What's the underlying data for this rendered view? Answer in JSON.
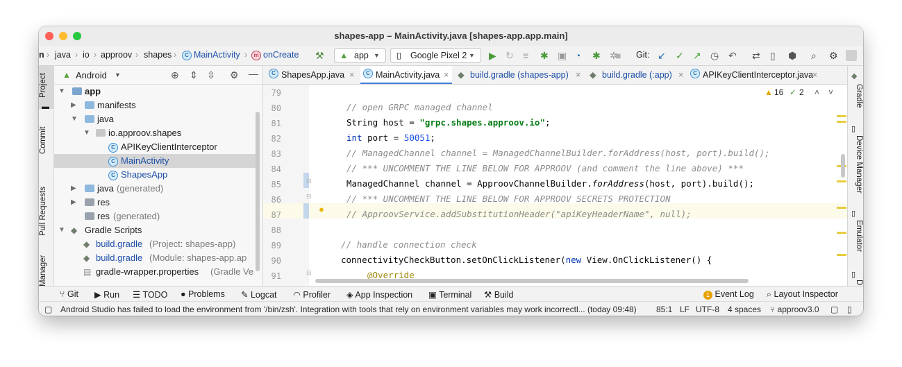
{
  "window": {
    "title": "shapes-app – MainActivity.java [shapes-app.app.main]"
  },
  "breadcrumb": [
    "n",
    "java",
    "io",
    "approov",
    "shapes",
    "MainActivity",
    "onCreate"
  ],
  "toolbar": {
    "run_config": "app",
    "device": "Google Pixel 2",
    "git_label": "Git:"
  },
  "left_tabs": [
    "Project",
    "Commit",
    "Pull Requests",
    "Manager"
  ],
  "right_tabs": [
    "Gradle",
    "Device Manager",
    "Emulator",
    "D"
  ],
  "project": {
    "view_mode": "Android",
    "tree": [
      {
        "label": "app",
        "extra": ""
      },
      {
        "label": "manifests",
        "extra": ""
      },
      {
        "label": "java",
        "extra": ""
      },
      {
        "label": "io.approov.shapes",
        "extra": ""
      },
      {
        "label": "APIKeyClientInterceptor",
        "extra": ""
      },
      {
        "label": "MainActivity",
        "extra": ""
      },
      {
        "label": "ShapesApp",
        "extra": ""
      },
      {
        "label": "java",
        "extra": "(generated)"
      },
      {
        "label": "res",
        "extra": ""
      },
      {
        "label": "res",
        "extra": "(generated)"
      },
      {
        "label": "Gradle Scripts",
        "extra": ""
      },
      {
        "label": "build.gradle",
        "extra": "(Project: shapes-app)"
      },
      {
        "label": "build.gradle",
        "extra": "(Module: shapes-app.ap"
      },
      {
        "label": "gradle-wrapper.properties",
        "extra": "(Gradle Ve"
      }
    ]
  },
  "tabs": [
    "ShapesApp.java",
    "MainActivity.java",
    "build.gradle (shapes-app)",
    "build.gradle (:app)",
    "APIKeyClientInterceptor.java"
  ],
  "inspections": {
    "warnings": "16",
    "weak_warnings": "2"
  },
  "editor": {
    "line_numbers": [
      "79",
      "80",
      "81",
      "82",
      "83",
      "84",
      "85",
      "86",
      "87",
      "88",
      "89",
      "90",
      "91"
    ],
    "lines": {
      "l80": "// open GRPC managed channel",
      "l81a": "String host = ",
      "l81b": "\"grpc.shapes.approov.io\"",
      "l81c": ";",
      "l82a": "int",
      "l82b": " port = ",
      "l82c": "50051",
      "l82d": ";",
      "l83": "// ManagedChannel channel = ManagedChannelBuilder.forAddress(host, port).build();",
      "l84": "// *** UNCOMMENT THE LINE BELOW FOR APPROOV (and comment the line above) ***",
      "l85a": "ManagedChannel channel = ApproovChannelBuilder.",
      "l85b": "forAddress",
      "l85c": "(host, port).build();",
      "l86": "// *** UNCOMMENT THE LINE BELOW FOR APPROOV SECRETS PROTECTION",
      "l87": "// ApproovService.addSubstitutionHeader(\"apiKeyHeaderName\", null);",
      "l89": "// handle connection check",
      "l90a": "connectivityCheckButton.setOnClickListener(",
      "l90b": "new",
      "l90c": " View.OnClickListener() {",
      "l91": "@Override"
    }
  },
  "bottom_tools": [
    "Git",
    "Run",
    "TODO",
    "Problems",
    "Logcat",
    "Profiler",
    "App Inspection",
    "Terminal",
    "Build",
    "Event Log",
    "Layout Inspector"
  ],
  "event_count": "1",
  "status": {
    "message": "Android Studio has failed to load the environment from '/bin/zsh'. Integration with tools that rely on environment variables may work incorrectl... (today 09:48)",
    "position": "85:1",
    "line_sep": "LF",
    "encoding": "UTF-8",
    "indent": "4 spaces",
    "branch": "approov3.0"
  },
  "colors": {
    "accent": "#3d7edb",
    "selected_row": "#d5d5d5",
    "current_line": "#fcfae8"
  }
}
